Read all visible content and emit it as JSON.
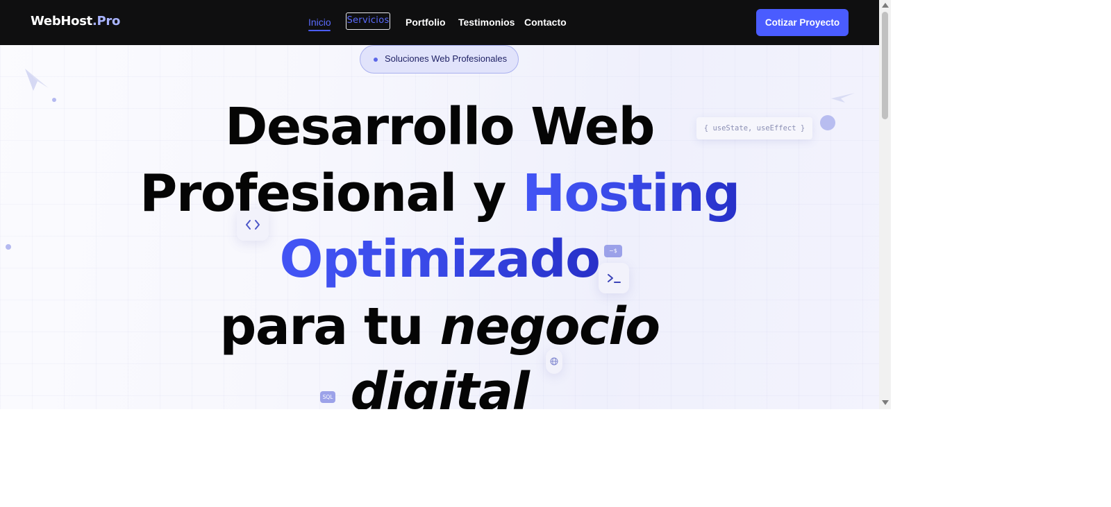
{
  "header": {
    "logo_main": "WebHost",
    "logo_ext": ".Pro",
    "nav": {
      "inicio": "Inicio",
      "servicios": "Servicios",
      "portfolio": "Portfolio",
      "testimonios": "Testimonios",
      "contacto": "Contacto"
    },
    "cta_label": "Cotizar Proyecto"
  },
  "hero": {
    "badge_text": "Soluciones Web Profesionales",
    "line1": "Desarrollo Web",
    "line2_a": "Profesional y ",
    "line2_b": "Hosting",
    "line3": "Optimizado",
    "line4_a": "para tu ",
    "line4_b": "negocio",
    "line5": "digital"
  },
  "decorations": {
    "code_chip": "{ useState, useEffect }",
    "tag_prompt": "~$",
    "tag_sql": "SQL",
    "icons": [
      "code-brackets-icon",
      "terminal-icon",
      "globe-icon"
    ]
  },
  "colors": {
    "navbar_bg": "#0f0f10",
    "accent": "#4a5cff",
    "headline": "#050505",
    "gradient_start": "#4355f5",
    "gradient_end": "#2730c8"
  }
}
